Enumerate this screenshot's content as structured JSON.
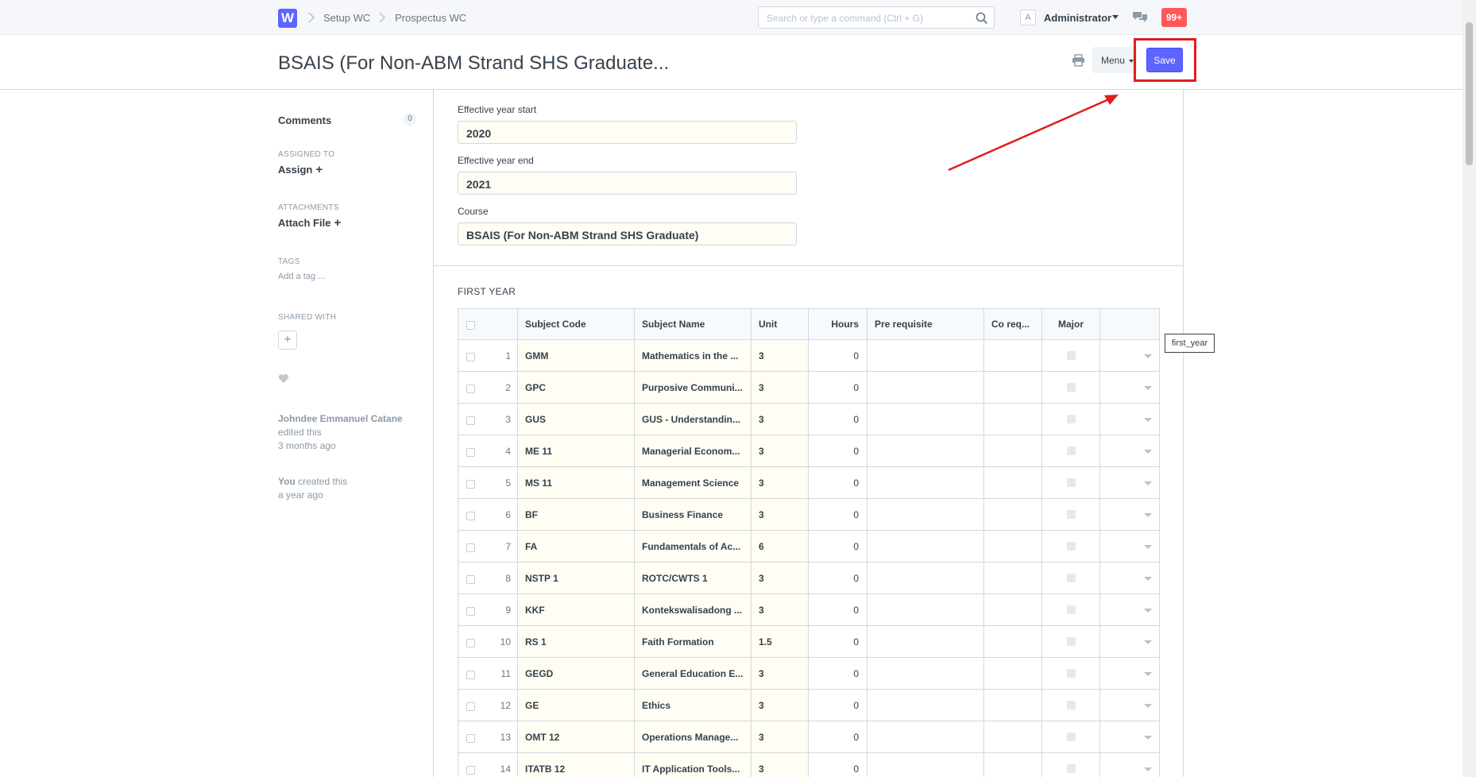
{
  "navbar": {
    "logo": "W",
    "breadcrumbs": [
      "Setup WC",
      "Prospectus WC"
    ],
    "search_placeholder": "Search or type a command (Ctrl + G)",
    "avatar_letter": "A",
    "user": "Administrator",
    "notifications": "99+"
  },
  "page": {
    "title": "BSAIS (For Non-ABM Strand SHS Graduate...",
    "menu_label": "Menu",
    "save_label": "Save"
  },
  "sidebar": {
    "comments_label": "Comments",
    "comments_count": "0",
    "assigned_to_label": "ASSIGNED TO",
    "assign_label": "Assign",
    "attachments_label": "ATTACHMENTS",
    "attach_label": "Attach File",
    "tags_label": "TAGS",
    "add_tag_label": "Add a tag ...",
    "shared_with_label": "SHARED WITH",
    "timeline": [
      {
        "who": "Johndee Emmanuel Catane",
        "action": "edited this",
        "when": "3 months ago"
      },
      {
        "who": "You",
        "action": "created this",
        "when": "a year ago"
      }
    ]
  },
  "form": {
    "year_start_label": "Effective year start",
    "year_start_value": "2020",
    "year_end_label": "Effective year end",
    "year_end_value": "2021",
    "course_label": "Course",
    "course_value": "BSAIS (For Non-ABM Strand SHS Graduate)",
    "section_title": "FIRST YEAR"
  },
  "grid": {
    "headers": {
      "code": "Subject Code",
      "name": "Subject Name",
      "unit": "Unit",
      "hours": "Hours",
      "prereq": "Pre requisite",
      "coreq": "Co req...",
      "major": "Major"
    },
    "rows": [
      {
        "idx": "1",
        "code": "GMM",
        "name": "Mathematics in the ...",
        "unit": "3",
        "hours": "0"
      },
      {
        "idx": "2",
        "code": "GPC",
        "name": "Purposive Communi...",
        "unit": "3",
        "hours": "0"
      },
      {
        "idx": "3",
        "code": "GUS",
        "name": "GUS - Understandin...",
        "unit": "3",
        "hours": "0"
      },
      {
        "idx": "4",
        "code": "ME 11",
        "name": "Managerial Econom...",
        "unit": "3",
        "hours": "0"
      },
      {
        "idx": "5",
        "code": "MS 11",
        "name": "Management Science",
        "unit": "3",
        "hours": "0"
      },
      {
        "idx": "6",
        "code": "BF",
        "name": "Business Finance",
        "unit": "3",
        "hours": "0"
      },
      {
        "idx": "7",
        "code": "FA",
        "name": "Fundamentals of Ac...",
        "unit": "6",
        "hours": "0"
      },
      {
        "idx": "8",
        "code": "NSTP 1",
        "name": "ROTC/CWTS 1",
        "unit": "3",
        "hours": "0"
      },
      {
        "idx": "9",
        "code": "KKF",
        "name": "Kontekswalisadong ...",
        "unit": "3",
        "hours": "0"
      },
      {
        "idx": "10",
        "code": "RS 1",
        "name": "Faith Formation",
        "unit": "1.5",
        "hours": "0"
      },
      {
        "idx": "11",
        "code": "GEGD",
        "name": "General Education E...",
        "unit": "3",
        "hours": "0"
      },
      {
        "idx": "12",
        "code": "GE",
        "name": "Ethics",
        "unit": "3",
        "hours": "0"
      },
      {
        "idx": "13",
        "code": "OMT 12",
        "name": "Operations Manage...",
        "unit": "3",
        "hours": "0"
      },
      {
        "idx": "14",
        "code": "ITATB 12",
        "name": "IT Application Tools...",
        "unit": "3",
        "hours": "0"
      }
    ]
  },
  "tooltip": "first_year",
  "colors": {
    "primary": "#5e64ff",
    "annotation_red": "#e01e1e",
    "notification_red": "#ff5858",
    "input_bg": "#fffdf4"
  },
  "icons": [
    "search-icon",
    "print-icon",
    "chat-icon",
    "heart-icon",
    "chevron-right-icon",
    "plus-icon"
  ]
}
